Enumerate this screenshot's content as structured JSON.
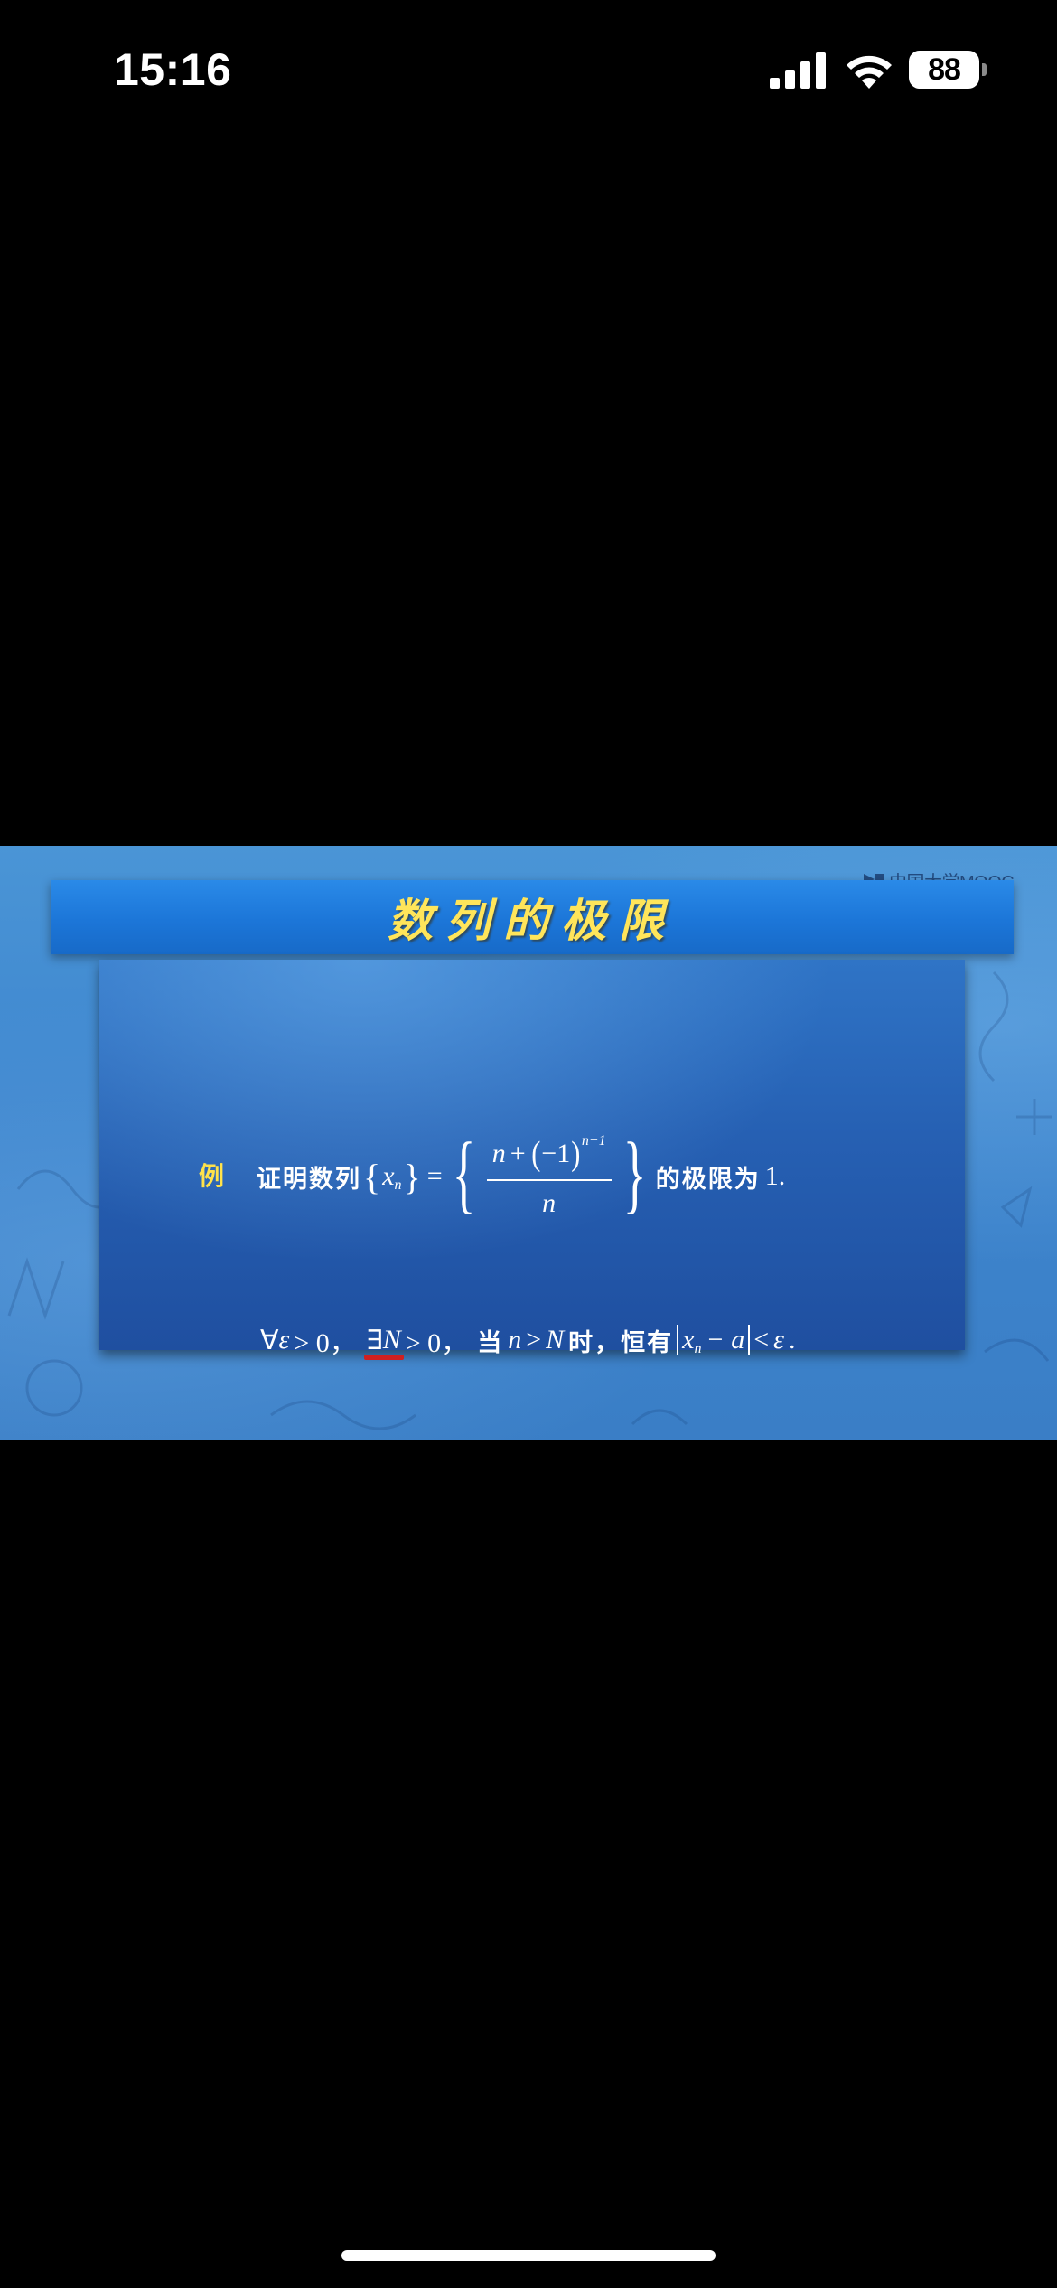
{
  "status_bar": {
    "time": "15:16",
    "battery_level": "88",
    "icons": [
      "cellular-signal-icon",
      "wifi-icon",
      "battery-icon"
    ]
  },
  "video": {
    "watermark": "中国大学MOOC",
    "title": "数列的极限",
    "example": {
      "label": "例",
      "prefix": "证明数列",
      "seq_var": "x",
      "seq_sub": "n",
      "eq": "=",
      "num_n": "n",
      "num_plus": "+",
      "num_base": "−1",
      "num_exp": "n+1",
      "den": "n",
      "suffix": "的极限为",
      "limit_value": "1."
    },
    "definition": {
      "forall": "∀",
      "epsilon": "ε",
      "gt0_a": "> 0，",
      "exists": "∃",
      "N": "N",
      "gt0_b": "> 0，",
      "when": "当",
      "n": "n",
      "gtN": ">",
      "N2": "N",
      "then": "时，恒有",
      "x": "x",
      "x_sub": "n",
      "minus_a": "− a",
      "lt": "<",
      "epsilon2": "ε",
      "period": "."
    },
    "colors": {
      "background": "#3f87cf",
      "banner": "#1f7ad8",
      "panel": "#2660b3",
      "title_text": "#ffe55a",
      "label_text": "#ffe24a",
      "underline": "#d02020"
    }
  }
}
